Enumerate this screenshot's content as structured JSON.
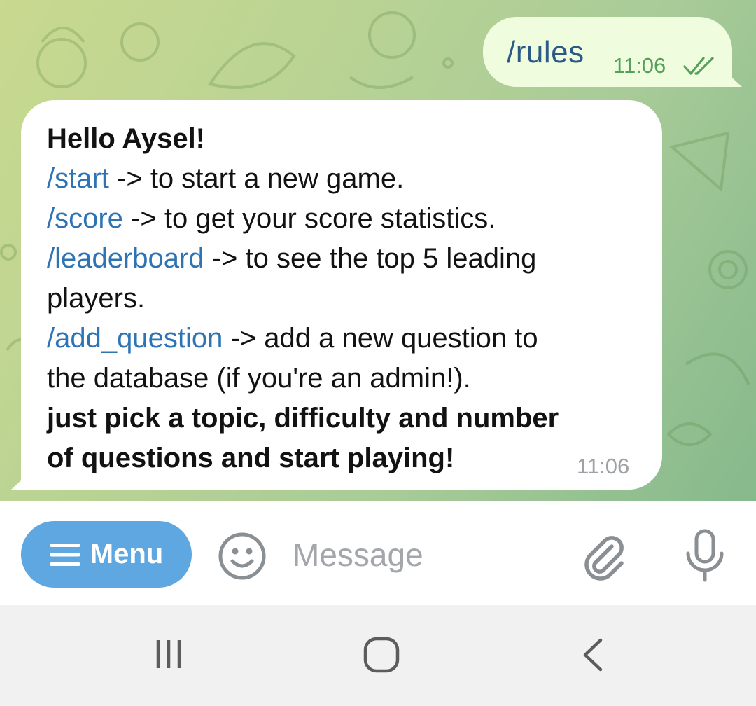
{
  "outgoing_message": {
    "text": "/rules",
    "time": "11:06",
    "status_icon": "double-check-icon"
  },
  "incoming_message": {
    "greeting": "Hello Aysel!",
    "commands": [
      {
        "command": "/start",
        "description": " -> to start a new game."
      },
      {
        "command": "/score",
        "description": " -> to get your score statistics."
      },
      {
        "command": "/leaderboard",
        "description": " -> to see the top 5 leading"
      },
      {
        "command": "/add_question",
        "description": " -> add a new question to"
      }
    ],
    "continuations": {
      "leaderboard": "players.",
      "add_question": "the database (if you're an admin!)."
    },
    "closing": {
      "line1": "just pick a topic, difficulty and number",
      "line2": "of questions and start playing!"
    },
    "time": "11:06"
  },
  "input_bar": {
    "menu_label": "Menu",
    "menu_icon": "hamburger-icon",
    "emoji_icon": "smiley-icon",
    "message_placeholder": "Message",
    "message_value": "",
    "attach_icon": "paperclip-icon",
    "mic_icon": "microphone-icon",
    "menu_color": "#5ea7e0"
  },
  "nav_bar": {
    "recent_icon": "recent-apps-icon",
    "home_icon": "home-icon",
    "back_icon": "back-icon"
  },
  "colors": {
    "command_link": "#2e74b5",
    "outgoing_bubble": "#effdde",
    "outgoing_time": "#55a15b",
    "incoming_bubble": "#ffffff"
  }
}
